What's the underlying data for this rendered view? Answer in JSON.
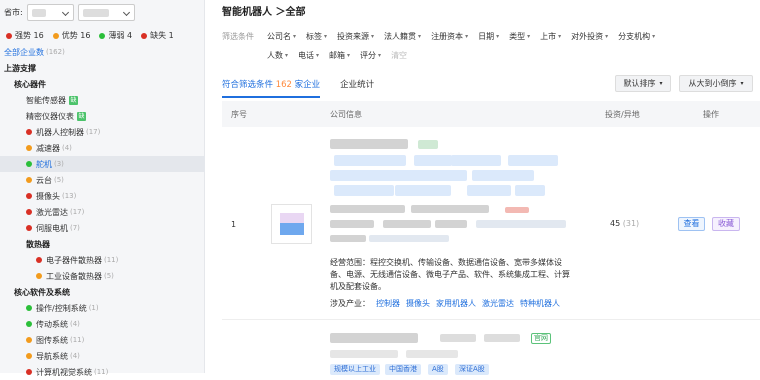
{
  "sidebar": {
    "province_label": "省市:",
    "legend": [
      {
        "label": "强势 16",
        "color": "#d93025"
      },
      {
        "label": "优势 16",
        "color": "#f29b1d"
      },
      {
        "label": "薄弱 4",
        "color": "#2bbf3a"
      },
      {
        "label": "缺失 1",
        "color": "#d93025"
      }
    ],
    "tree": [
      {
        "label": "全部企业数",
        "count": "(162)",
        "level": 0,
        "style": "blue",
        "selected": false
      },
      {
        "label": "上游支撑",
        "level": 0,
        "style": "bold"
      },
      {
        "label": "核心器件",
        "level": 1,
        "style": "bold"
      },
      {
        "label": "智能传感器",
        "level": 2,
        "tag": "缺"
      },
      {
        "label": "精密仪器仪表",
        "level": 2,
        "tag": "缺"
      },
      {
        "label": "机器人控制器",
        "count": "(17)",
        "level": 2,
        "dot": "#d93025"
      },
      {
        "label": "减速器",
        "count": "(4)",
        "level": 2,
        "dot": "#f29b1d"
      },
      {
        "label": "舵机",
        "count": "(3)",
        "level": 2,
        "dot": "#2bbf3a",
        "style": "blue",
        "selected": true
      },
      {
        "label": "云台",
        "count": "(5)",
        "level": 2,
        "dot": "#f29b1d"
      },
      {
        "label": "摄像头",
        "count": "(13)",
        "level": 2,
        "dot": "#d93025"
      },
      {
        "label": "激光雷达",
        "count": "(17)",
        "level": 2,
        "dot": "#d93025"
      },
      {
        "label": "伺服电机",
        "count": "(7)",
        "level": 2,
        "dot": "#d93025"
      },
      {
        "label": "散热器",
        "level": 2,
        "style": "bold"
      },
      {
        "label": "电子器件散热器",
        "count": "(11)",
        "level": 3,
        "dot": "#d93025"
      },
      {
        "label": "工业设备散热器",
        "count": "(5)",
        "level": 3,
        "dot": "#f29b1d"
      },
      {
        "label": "核心软件及系统",
        "level": 1,
        "style": "bold"
      },
      {
        "label": "操作/控制系统",
        "count": "(1)",
        "level": 2,
        "dot": "#2bbf3a"
      },
      {
        "label": "传动系统",
        "count": "(4)",
        "level": 2,
        "dot": "#2bbf3a"
      },
      {
        "label": "图传系统",
        "count": "(11)",
        "level": 2,
        "dot": "#f29b1d"
      },
      {
        "label": "导航系统",
        "count": "(4)",
        "level": 2,
        "dot": "#f29b1d"
      },
      {
        "label": "计算机视觉系统",
        "count": "(11)",
        "level": 2,
        "dot": "#d93025"
      }
    ]
  },
  "main": {
    "breadcrumb": "智能机器人 ＞全部",
    "filter_label": "筛选条件",
    "filters_row1": [
      "公司名",
      "标签",
      "投资来源",
      "法人籍贯",
      "注册资本",
      "日期",
      "类型",
      "上市",
      "对外投资",
      "分支机构"
    ],
    "filters_row2": [
      "人数",
      "电话",
      "邮箱",
      "评分"
    ],
    "clear": "清空",
    "tab1_prefix": "符合筛选条件 ",
    "tab1_num": "162",
    "tab1_suffix": " 家企业",
    "tab2": "企业统计",
    "sort1": "默认排序",
    "sort2": "从大到小倒序",
    "col_no": "序号",
    "col_company": "公司信息",
    "col_invest": "投资/异地",
    "col_action": "操作",
    "row1": {
      "no": "1",
      "invest": "45",
      "invest_sub": "(31)",
      "scope": "经营范围：程控交换机、传输设备、数据通信设备、宽带多媒体设备、电源、无线通信设备、微电子产品、软件、系统集成工程、计算机及配套设备。",
      "industry_label": "涉及产业：",
      "industries": [
        "控制器",
        "摄像头",
        "家用机器人",
        "激光雷达",
        "特种机器人"
      ],
      "view": "查看",
      "collect": "收藏"
    },
    "row2": {
      "badge": "官网",
      "tags": [
        "规模以上工业",
        "中国香港",
        "A股",
        "深证A股"
      ]
    }
  }
}
